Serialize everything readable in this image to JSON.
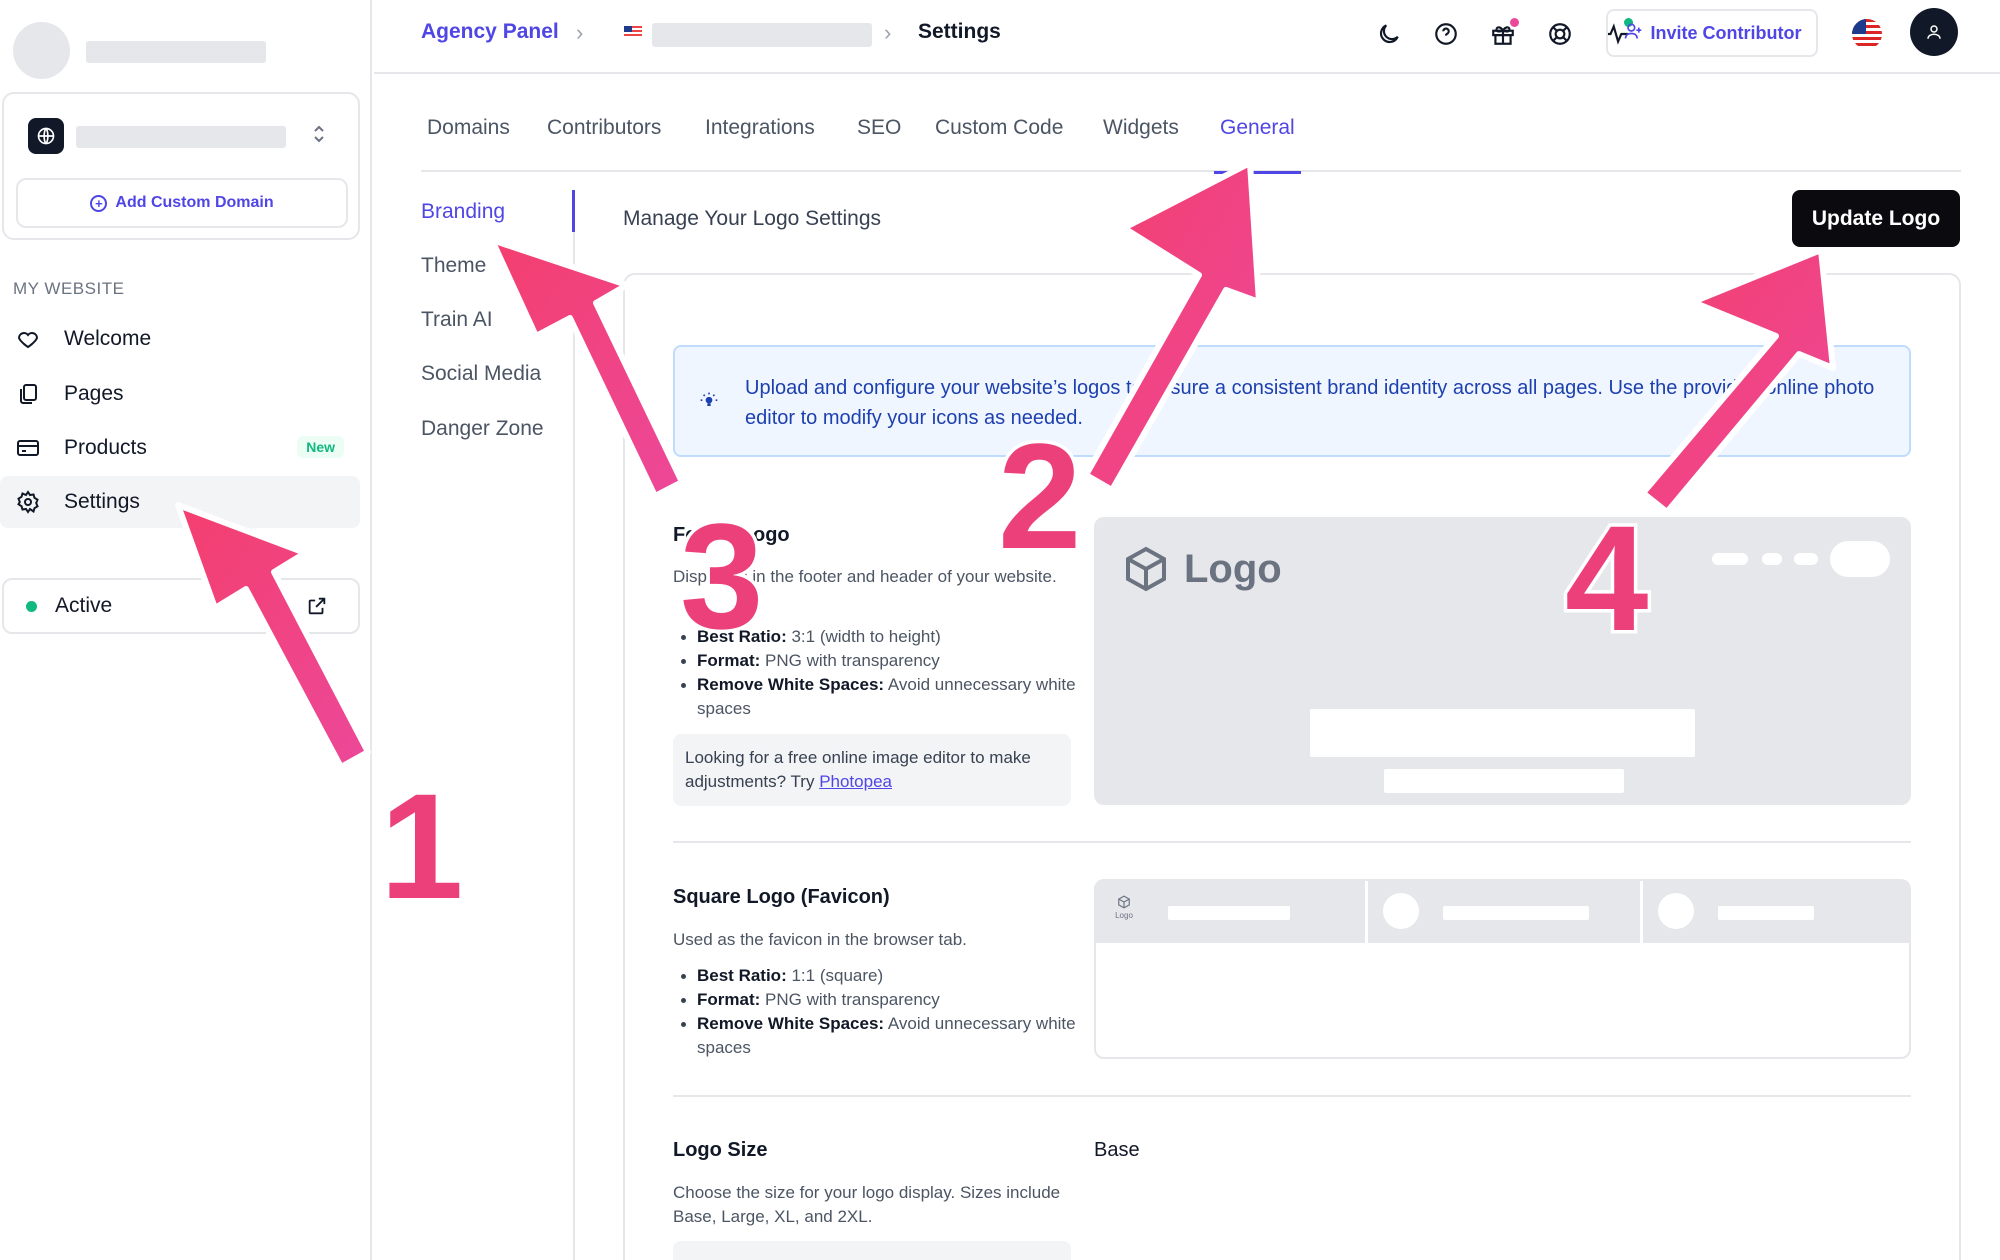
{
  "sidebar": {
    "add_custom_domain": "Add Custom Domain",
    "section_label": "MY WEBSITE",
    "items": [
      {
        "label": "Welcome",
        "icon": "heart-icon"
      },
      {
        "label": "Pages",
        "icon": "pages-icon"
      },
      {
        "label": "Products",
        "icon": "card-icon",
        "badge": "New"
      },
      {
        "label": "Settings",
        "icon": "gear-icon",
        "active": true
      }
    ],
    "status": "Active"
  },
  "header": {
    "breadcrumb_root": "Agency Panel",
    "breadcrumb_current": "Settings",
    "invite_label": "Invite Contributor"
  },
  "tabs": [
    "Domains",
    "Contributors",
    "Integrations",
    "SEO",
    "Custom Code",
    "Widgets",
    "General"
  ],
  "active_tab": "General",
  "subnav": [
    "Branding",
    "Theme",
    "Train AI",
    "Social Media",
    "Danger Zone"
  ],
  "active_subnav": "Branding",
  "content": {
    "title": "Manage Your Logo Settings",
    "update_button": "Update Logo",
    "alert_text": "Upload and configure your website’s logos to ensure a consistent brand identity across all pages. Use the provided online photo editor to modify your icons as needed.",
    "footer_logo": {
      "title": "Footer Logo",
      "description": "Displayed in the footer and header of your website.",
      "ratio_label": "Best Ratio:",
      "ratio_value": "3:1 (width to height)",
      "format_label": "Format:",
      "format_value": "PNG with transparency",
      "spaces_label": "Remove White Spaces:",
      "spaces_value": "Avoid unnecessary white spaces",
      "tip_text": "Looking for a free online image editor to make adjustments? Try",
      "tip_link": "Photopea",
      "preview_logo_text": "Logo"
    },
    "square_logo": {
      "title": "Square Logo (Favicon)",
      "description": "Used as the favicon in the browser tab.",
      "ratio_label": "Best Ratio:",
      "ratio_value": "1:1 (square)",
      "format_label": "Format:",
      "format_value": "PNG with transparency",
      "spaces_label": "Remove White Spaces:",
      "spaces_value": "Avoid unnecessary white spaces",
      "preview_fav_text": "Logo"
    },
    "logo_size": {
      "title": "Logo Size",
      "description": "Choose the size for your logo display. Sizes include Base, Large, XL, and 2XL.",
      "value": "Base"
    }
  },
  "annotations": [
    "1",
    "2",
    "3",
    "4"
  ],
  "colors": {
    "accent": "#4f46e5",
    "annotation": "#ec407a",
    "success": "#10b981"
  }
}
